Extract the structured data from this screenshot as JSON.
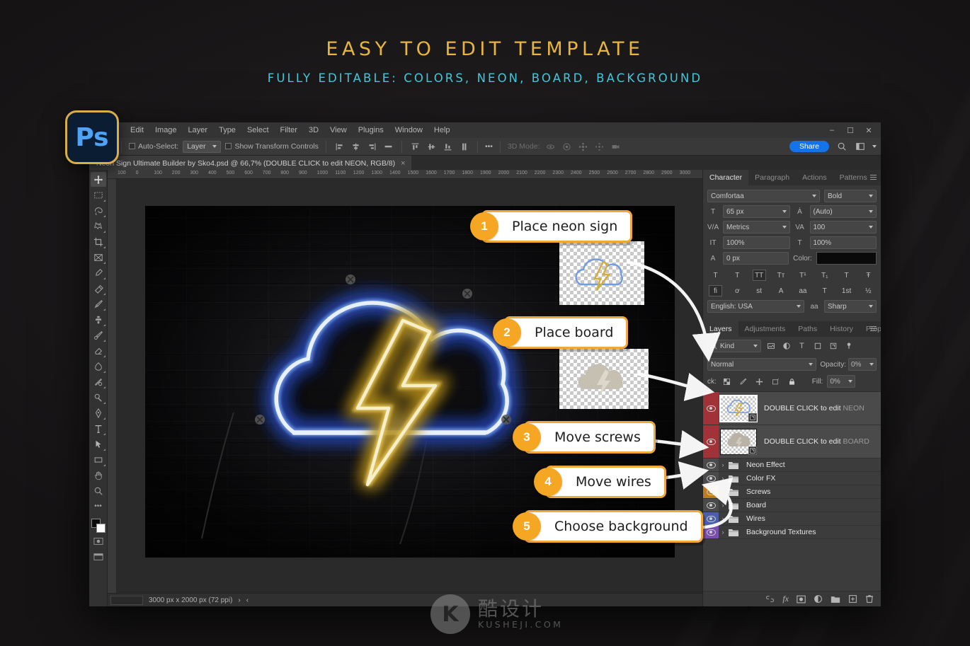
{
  "headings": {
    "title": "EASY TO EDIT TEMPLATE",
    "subtitle": "FULLY EDITABLE: COLORS, NEON, BOARD, BACKGROUND"
  },
  "colors": {
    "title_gold": "#e8b63c",
    "subtitle_cyan": "#45c8db",
    "callout_orange": "#f5a623",
    "callout_border": "#f0a83a",
    "share_blue": "#1473e6",
    "layer_selected_red": "#a03238",
    "screws_group": "#c07d15",
    "wires_group": "#4a5fa8",
    "background_group": "#7b4fae"
  },
  "app": {
    "logo_label": "Ps",
    "menu": [
      "Edit",
      "Image",
      "Layer",
      "Type",
      "Select",
      "Filter",
      "3D",
      "View",
      "Plugins",
      "Window",
      "Help"
    ],
    "window_controls": [
      "minimize",
      "maximize",
      "close"
    ],
    "document_tab": "Neon Sign Ultimate Builder by Sko4.psd @ 66,7% (DOUBLE CLICK to edit NEON, RGB/8)",
    "tab_close": "×"
  },
  "options_bar": {
    "tool_icon": "move-tool-icon",
    "auto_select_label": "Auto-Select:",
    "auto_select_value": "Layer",
    "show_transform_label": "Show Transform Controls",
    "more_label": "•••",
    "three_d_mode_label": "3D Mode:",
    "share_label": "Share",
    "align_icons": [
      "align-left",
      "align-center-h",
      "align-right",
      "distribute-h",
      "align-top",
      "align-center-v",
      "align-bottom",
      "distribute-v"
    ],
    "three_d_icons": [
      "orbit-3d",
      "roll-3d",
      "pan-3d",
      "slide-3d",
      "camera-3d"
    ],
    "right_icons": [
      "search-icon",
      "workspace-icon",
      "chevron-down-icon"
    ]
  },
  "toolbox": {
    "tools": [
      "move-tool",
      "rectangular-marquee-tool",
      "lasso-tool",
      "object-selection-tool",
      "crop-tool",
      "frame-tool",
      "eyedropper-tool",
      "spot-healing-brush-tool",
      "brush-tool",
      "clone-stamp-tool",
      "history-brush-tool",
      "eraser-tool",
      "gradient-tool",
      "blur-tool",
      "dodge-tool",
      "pen-tool",
      "type-tool",
      "path-selection-tool",
      "rectangle-tool",
      "hand-tool",
      "zoom-tool"
    ],
    "more_tools": "•••",
    "foreground_color": "#0d0d0d",
    "background_color": "#ffffff"
  },
  "ruler": {
    "labels": [
      "100",
      "0",
      "100",
      "200",
      "300",
      "400",
      "500",
      "600",
      "700",
      "800",
      "900",
      "1000",
      "1100",
      "1200",
      "1300",
      "1400",
      "1500",
      "1600",
      "1700",
      "1800",
      "1900",
      "2000",
      "2100",
      "2200",
      "2300",
      "2400",
      "2500",
      "2600",
      "2700",
      "2800",
      "2900",
      "3000"
    ]
  },
  "status_bar": {
    "zoom_value": "",
    "doc_size": "3000 px x 2000 px (72 ppi)",
    "next_glyph": "›",
    "prev_glyph": "‹"
  },
  "character_panel": {
    "tabs": [
      "Character",
      "Paragraph",
      "Actions",
      "Patterns"
    ],
    "active_tab": "Character",
    "font_family": "Comfortaa",
    "font_style": "Bold",
    "font_size": "65 px",
    "leading": "(Auto)",
    "kerning": "Metrics",
    "tracking": "100",
    "vertical_scale": "100%",
    "horizontal_scale": "100%",
    "baseline_shift": "0 px",
    "color_label": "Color:",
    "color_value": "#000000",
    "style_glyphs": [
      "T",
      "T",
      "TT",
      "Tт",
      "T¹",
      "T₁",
      "T",
      "Ŧ"
    ],
    "ligature_glyphs": [
      "fi",
      "ơ",
      "st",
      "A",
      "aa",
      "T",
      "1st",
      "½"
    ],
    "language": "English: USA",
    "antialias": "Sharp",
    "size_icon": "font-size-icon",
    "leading_icon": "leading-icon",
    "kerning_icon": "kerning-icon",
    "tracking_icon": "tracking-icon",
    "vscale_icon": "vertical-scale-icon",
    "hscale_icon": "horizontal-scale-icon",
    "baseline_icon": "baseline-shift-icon"
  },
  "layers_panel": {
    "tabs": [
      "Layers",
      "Adjustments",
      "Paths",
      "History",
      "Properties"
    ],
    "active_tab": "Layers",
    "filter_label": "Kind",
    "filter_icons": [
      "pixel-filter-icon",
      "adjustment-filter-icon",
      "type-filter-icon",
      "shape-filter-icon",
      "smart-object-filter-icon",
      "filter-toggle-icon"
    ],
    "blend_mode": "Normal",
    "opacity_label": "Opacity:",
    "opacity_value": "0%",
    "lock_label": "ck:",
    "fill_label": "Fill:",
    "fill_value": "0%",
    "lock_icons": [
      "lock-transparency-icon",
      "lock-image-icon",
      "lock-position-icon",
      "lock-artboard-icon",
      "lock-all-icon"
    ],
    "layers": [
      {
        "name": "DOUBLE CLICK to edit ",
        "highlight": "NEON",
        "type": "smart-object",
        "selected": true,
        "color": "#a03238",
        "thumb": "neon-cloud-thumb"
      },
      {
        "name": "DOUBLE CLICK to edit ",
        "highlight": "BOARD",
        "type": "smart-object",
        "selected": true,
        "color": "#a03238",
        "thumb": "board-cloud-thumb"
      },
      {
        "name": "Neon Effect",
        "type": "group",
        "color": "#4a4a4a"
      },
      {
        "name": "Color FX",
        "type": "group",
        "color": "#4a4a4a"
      },
      {
        "name": "Screws",
        "type": "group",
        "color": "#c07d15"
      },
      {
        "name": "Board",
        "type": "group",
        "color": "#4a4a4a"
      },
      {
        "name": "Wires",
        "type": "group",
        "color": "#4a5fa8"
      },
      {
        "name": "Background Textures",
        "type": "group",
        "color": "#7b4fae"
      }
    ],
    "footer_icons": [
      "link-layers-icon",
      "fx-icon",
      "layer-mask-icon",
      "adjustment-layer-icon",
      "new-group-icon",
      "new-layer-icon",
      "delete-layer-icon"
    ],
    "fx_label": "fx"
  },
  "callouts": [
    {
      "number": "1",
      "text": "Place neon sign"
    },
    {
      "number": "2",
      "text": "Place board"
    },
    {
      "number": "3",
      "text": "Move screws"
    },
    {
      "number": "4",
      "text": "Move wires"
    },
    {
      "number": "5",
      "text": "Choose background"
    }
  ],
  "thumb_cards": [
    {
      "name": "neon-sign-transparent-thumb"
    },
    {
      "name": "board-transparent-thumb"
    }
  ],
  "watermark": {
    "mark": "K",
    "cn": "酷设计",
    "en": "KUSHEJI.COM"
  }
}
